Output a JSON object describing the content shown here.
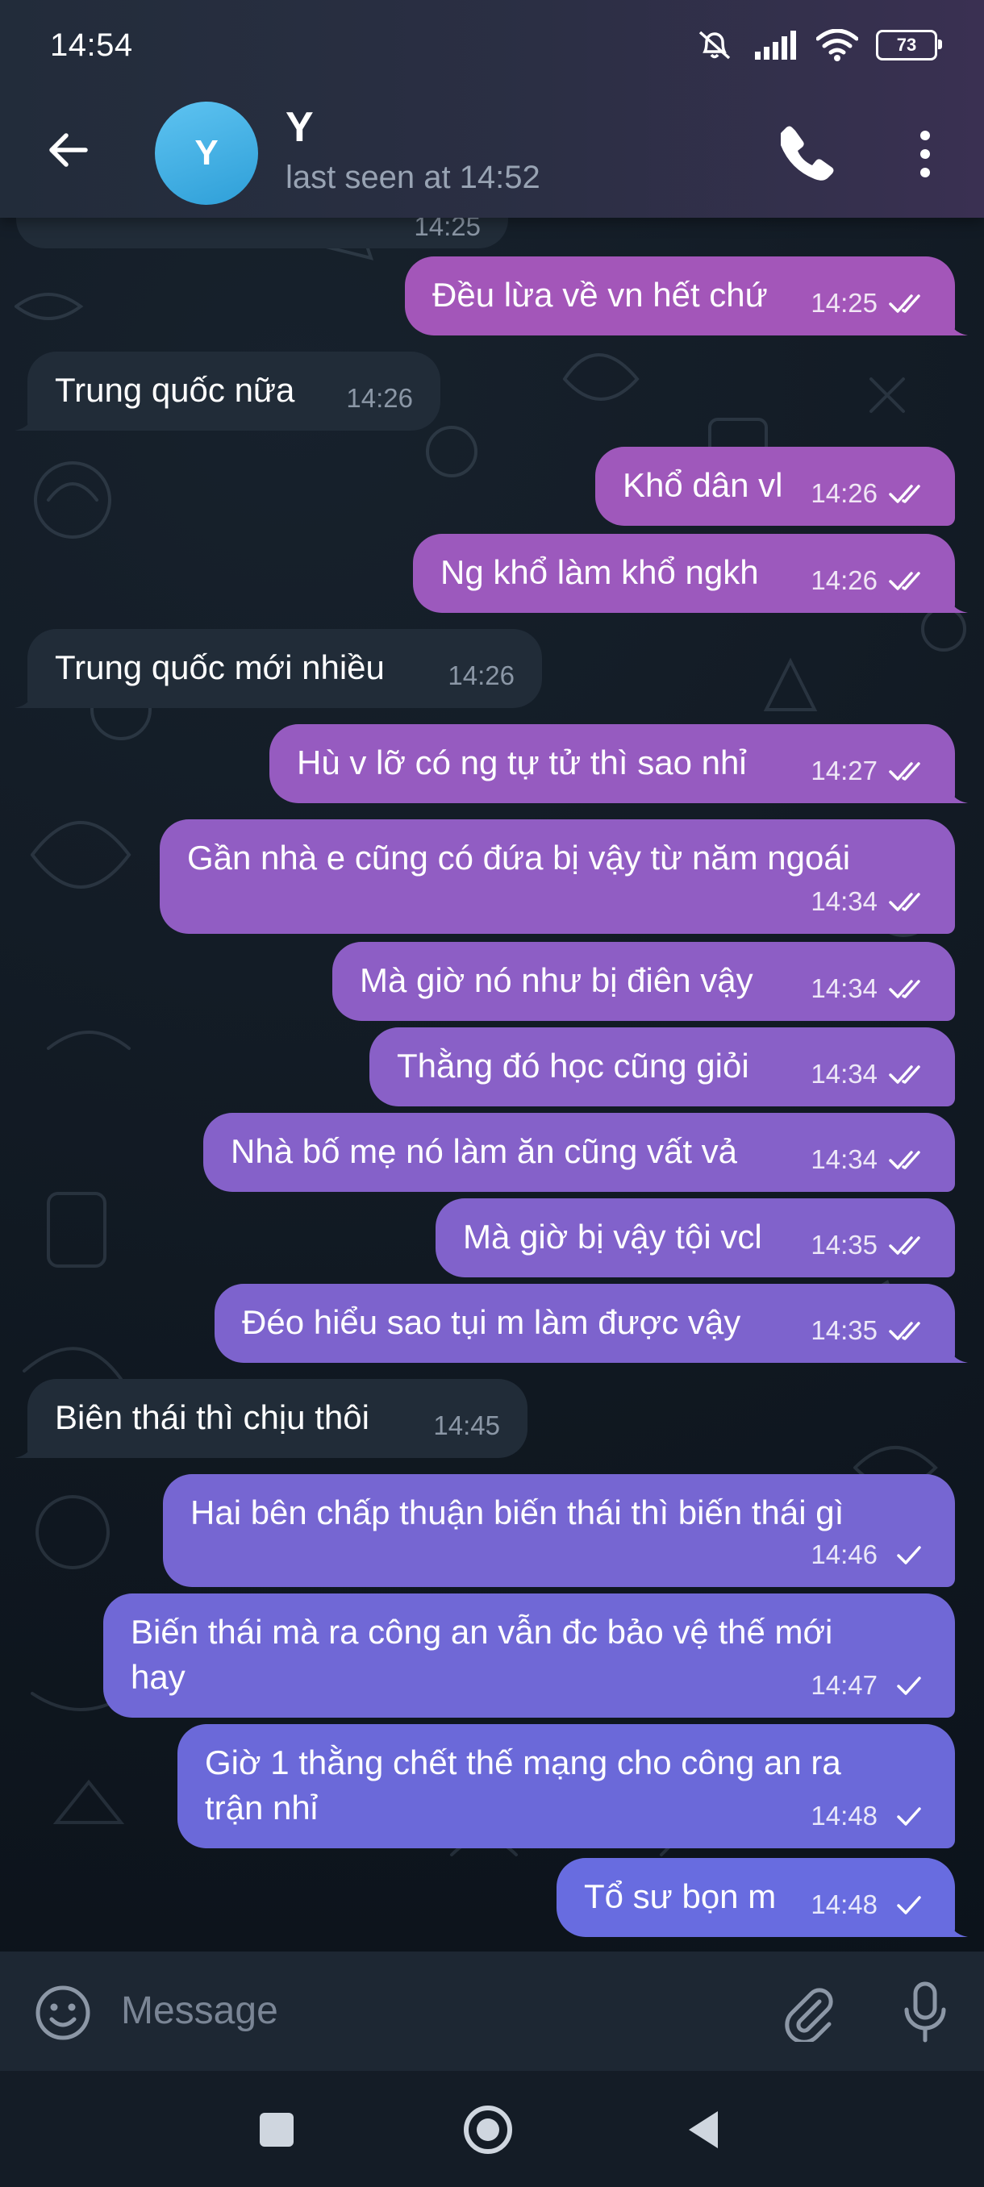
{
  "status_bar": {
    "time": "14:54",
    "battery_level": "73"
  },
  "header": {
    "avatar_initial": "Y",
    "contact_name": "Y",
    "last_seen": "last seen at 14:52"
  },
  "colors": {
    "bubble_incoming": "#212c38",
    "bubble_out_top": "#a356b9",
    "bubble_out_bottom": "#6b6cf0",
    "avatar": "#3aa9e2"
  },
  "partial_message": {
    "time": "14:25"
  },
  "messages": [
    {
      "direction": "out",
      "text": "Đều lừa về vn hết chứ",
      "time": "14:25",
      "status": "read"
    },
    {
      "direction": "in",
      "text": "Trung quốc nữa",
      "time": "14:26"
    },
    {
      "direction": "out",
      "text": "Khổ dân vl",
      "time": "14:26",
      "status": "read"
    },
    {
      "direction": "out",
      "text": "Ng khổ làm khổ ngkh",
      "time": "14:26",
      "status": "read"
    },
    {
      "direction": "in",
      "text": "Trung quốc mới nhiều",
      "time": "14:26"
    },
    {
      "direction": "out",
      "text": "Hù v lỡ có ng tự tử thì sao nhỉ",
      "time": "14:27",
      "status": "read"
    },
    {
      "direction": "out",
      "text": "Gần nhà e cũng có đứa bị vậy từ năm ngoái",
      "time": "14:34",
      "status": "read"
    },
    {
      "direction": "out",
      "text": "Mà giờ nó như bị điên vậy",
      "time": "14:34",
      "status": "read"
    },
    {
      "direction": "out",
      "text": "Thằng đó học cũng giỏi",
      "time": "14:34",
      "status": "read"
    },
    {
      "direction": "out",
      "text": "Nhà bố mẹ nó làm ăn cũng vất vả",
      "time": "14:34",
      "status": "read"
    },
    {
      "direction": "out",
      "text": "Mà giờ bị vậy tội vcl",
      "time": "14:35",
      "status": "read"
    },
    {
      "direction": "out",
      "text": "Đéo hiểu sao tụi m làm được vậy",
      "time": "14:35",
      "status": "read"
    },
    {
      "direction": "in",
      "text": "Biên thái thì chịu thôi",
      "time": "14:45"
    },
    {
      "direction": "out",
      "text": "Hai bên chấp thuận biến thái thì biến thái gì",
      "time": "14:46",
      "status": "sent"
    },
    {
      "direction": "out",
      "text": "Biến thái mà ra công an vẫn đc bảo vệ thế mới",
      "text2": "hay",
      "time": "14:47",
      "status": "sent"
    },
    {
      "direction": "out",
      "text": "Giờ 1 thằng chết thế mạng cho công an ra",
      "text2": "trận nhỉ",
      "time": "14:48",
      "status": "sent"
    },
    {
      "direction": "out",
      "text": "Tổ sư bọn m",
      "time": "14:48",
      "status": "sent"
    }
  ],
  "composer": {
    "placeholder": "Message"
  }
}
